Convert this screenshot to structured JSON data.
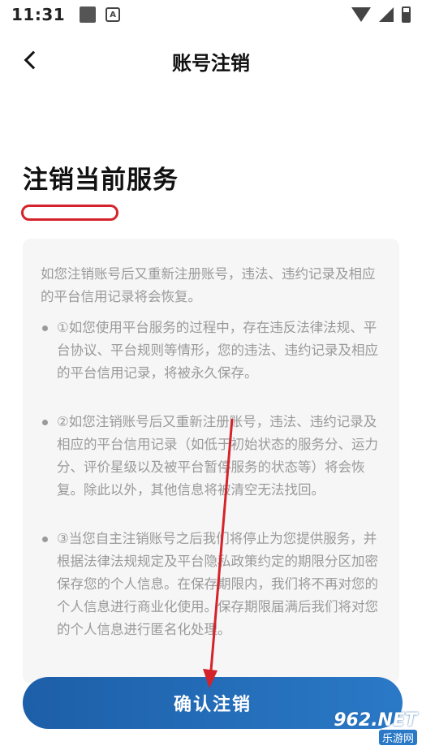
{
  "status_bar": {
    "time": "11:31",
    "a_icon": "A"
  },
  "header": {
    "back_icon": "chevron-left-icon",
    "title": "账号注销"
  },
  "section": {
    "heading": "注销当前服务"
  },
  "card": {
    "intro": "如您注销账号后又重新注册账号，违法、违约记录及相应的平台信用记录将会恢复。",
    "items": [
      "①如您使用平台服务的过程中，存在违反法律法规、平台协议、平台规则等情形，您的违法、违约记录及相应的平台信用记录，将被永久保存。",
      "②如您注销账号后又重新注册账号，违法、违约记录及相应的平台信用记录（如低于初始状态的服务分、运力分、评价星级以及被平台暂停服务的状态等）将会恢复。除此以外，其他信息将被清空无法找回。",
      "③当您自主注销账号之后我们将停止为您提供服务，并根据法律法规规定及平台隐私政策约定的期限分区加密保存您的个人信息。在保存期限内，我们将不再对您的个人信息进行商业化使用。保存期限届满后我们将对您的个人信息进行匿名化处理。"
    ]
  },
  "confirm_button": {
    "label": "确认注销",
    "color_start": "#1d5fa8",
    "color_end": "#2a79c7"
  },
  "annotation": {
    "color": "#d4232b"
  },
  "watermark": {
    "top_prefix": "962",
    "top_suffix": ".NET",
    "bottom": "乐游网"
  }
}
